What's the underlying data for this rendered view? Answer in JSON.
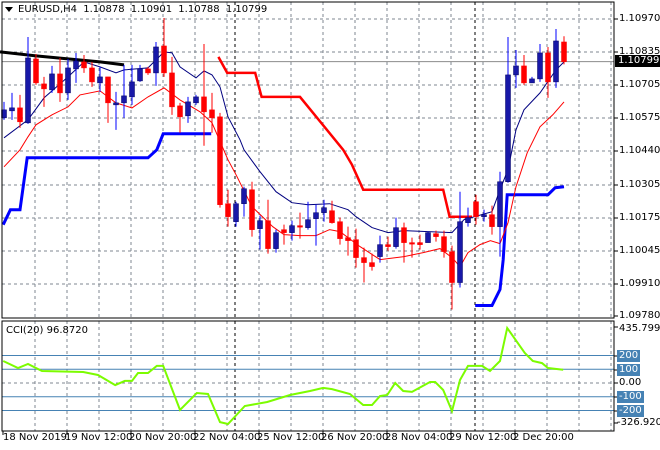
{
  "header": {
    "symbol": "EURUSD,H4",
    "open": "1.10878",
    "high": "1.10901",
    "low": "1.10788",
    "close": "1.10799"
  },
  "price_axis": [
    "1.10970",
    "1.10835",
    "1.10705",
    "1.10575",
    "1.10440",
    "1.10305",
    "1.10175",
    "1.10045",
    "1.09910",
    "1.09780"
  ],
  "current_price": "1.10799",
  "time_axis": [
    "18 Nov 2019",
    "19 Nov 12:00",
    "20 Nov 20:00",
    "22 Nov 04:00",
    "25 Nov 12:00",
    "26 Nov 20:00",
    "28 Nov 04:00",
    "29 Nov 12:00",
    "2 Dec 20:00"
  ],
  "indicator": {
    "label": "CCI(20) 96.8720",
    "max": "435.799",
    "min": "-326.9205",
    "zero": "0.00",
    "levels": [
      "200",
      "100",
      "-100",
      "-200"
    ]
  },
  "colors": {
    "bull": "#1818a8",
    "bear": "#ff0000",
    "ma_fast": "#000080",
    "ma_slow": "#ff0000",
    "stop_up": "#0000ff",
    "stop_down": "#ff0000",
    "cci": "#7cfc00",
    "level": "#4682b4"
  },
  "chart_data": {
    "type": "candlestick",
    "price_range": [
      1.0978,
      1.1097
    ],
    "ohlc": [
      [
        1.10574,
        1.10638,
        1.10566,
        1.10606
      ],
      [
        1.10602,
        1.10674,
        1.10566,
        1.10614
      ],
      [
        1.10614,
        1.10666,
        1.10534,
        1.10558
      ],
      [
        1.10554,
        1.10898,
        1.1055,
        1.10814
      ],
      [
        1.1081,
        1.1083,
        1.10706,
        1.10714
      ],
      [
        1.1071,
        1.10738,
        1.10618,
        1.1069
      ],
      [
        1.10686,
        1.10782,
        1.10674,
        1.1075
      ],
      [
        1.1075,
        1.10814,
        1.10638,
        1.10674
      ],
      [
        1.10674,
        1.1081,
        1.10646,
        1.10774
      ],
      [
        1.1077,
        1.10834,
        1.10714,
        1.10802
      ],
      [
        1.10798,
        1.10826,
        1.10754,
        1.10774
      ],
      [
        1.10774,
        1.10798,
        1.10698,
        1.10718
      ],
      [
        1.10714,
        1.10778,
        1.10678,
        1.10738
      ],
      [
        1.10738,
        1.10738,
        1.10554,
        1.10634
      ],
      [
        1.10626,
        1.10678,
        1.10526,
        1.10634
      ],
      [
        1.10634,
        1.10786,
        1.10574,
        1.10662
      ],
      [
        1.10658,
        1.10786,
        1.10626,
        1.10718
      ],
      [
        1.10722,
        1.10786,
        1.10718,
        1.1077
      ],
      [
        1.1077,
        1.10778,
        1.10746,
        1.10754
      ],
      [
        1.10754,
        1.10878,
        1.10702,
        1.10858
      ],
      [
        1.10862,
        1.10974,
        1.10738,
        1.10754
      ],
      [
        1.10754,
        1.10818,
        1.10586,
        1.10618
      ],
      [
        1.10622,
        1.10634,
        1.10514,
        1.10578
      ],
      [
        1.10582,
        1.10658,
        1.10554,
        1.10638
      ],
      [
        1.10634,
        1.10666,
        1.10626,
        1.10658
      ],
      [
        1.10658,
        1.1087,
        1.10462,
        1.10598
      ],
      [
        1.10606,
        1.10674,
        1.10514,
        1.10574
      ],
      [
        1.10578,
        1.10594,
        1.10214,
        1.10226
      ],
      [
        1.1023,
        1.10286,
        1.10138,
        1.10178
      ],
      [
        1.10158,
        1.10238,
        1.10138,
        1.1023
      ],
      [
        1.1023,
        1.10298,
        1.10178,
        1.1029
      ],
      [
        1.10286,
        1.10318,
        1.10098,
        1.10126
      ],
      [
        1.1013,
        1.10182,
        1.10046,
        1.10162
      ],
      [
        1.10162,
        1.10246,
        1.1003,
        1.1005
      ],
      [
        1.1005,
        1.10126,
        1.10034,
        1.10114
      ],
      [
        1.10126,
        1.10146,
        1.10066,
        1.10114
      ],
      [
        1.10114,
        1.10162,
        1.10082,
        1.10142
      ],
      [
        1.10142,
        1.10194,
        1.1009,
        1.10138
      ],
      [
        1.10134,
        1.10238,
        1.10126,
        1.10166
      ],
      [
        1.1017,
        1.10226,
        1.10062,
        1.10194
      ],
      [
        1.10194,
        1.10246,
        1.10158,
        1.10214
      ],
      [
        1.10202,
        1.10242,
        1.1015,
        1.10154
      ],
      [
        1.10158,
        1.10174,
        1.10066,
        1.1009
      ],
      [
        1.10094,
        1.10138,
        1.10022,
        1.10082
      ],
      [
        1.10086,
        1.1013,
        1.09974,
        1.10014
      ],
      [
        1.10014,
        1.10054,
        1.09914,
        1.09994
      ],
      [
        1.09994,
        1.1003,
        1.09962,
        1.09978
      ],
      [
        1.10018,
        1.10102,
        1.09994,
        1.10066
      ],
      [
        1.10066,
        1.10098,
        1.10042,
        1.10058
      ],
      [
        1.10058,
        1.10174,
        1.1005,
        1.10134
      ],
      [
        1.10134,
        1.10154,
        1.09994,
        1.10074
      ],
      [
        1.10074,
        1.10094,
        1.10014,
        1.1007
      ],
      [
        1.10074,
        1.10106,
        1.10046,
        1.10066
      ],
      [
        1.10074,
        1.10118,
        1.10074,
        1.10114
      ],
      [
        1.1011,
        1.10122,
        1.10078,
        1.10098
      ],
      [
        1.10098,
        1.10122,
        1.10014,
        1.10038
      ],
      [
        1.10038,
        1.10062,
        1.09806,
        1.09914
      ],
      [
        1.09914,
        1.10278,
        1.09894,
        1.10158
      ],
      [
        1.10154,
        1.10214,
        1.10138,
        1.10174
      ],
      [
        1.10238,
        1.10266,
        1.10146,
        1.10178
      ],
      [
        1.10178,
        1.10206,
        1.10158,
        1.10186
      ],
      [
        1.10186,
        1.10222,
        1.10106,
        1.10138
      ],
      [
        1.10138,
        1.10358,
        1.10018,
        1.10318
      ],
      [
        1.10318,
        1.10898,
        1.10314,
        1.10746
      ],
      [
        1.10746,
        1.10846,
        1.10694,
        1.10782
      ],
      [
        1.10782,
        1.10826,
        1.10706,
        1.10714
      ],
      [
        1.10714,
        1.10738,
        1.10714,
        1.1073
      ],
      [
        1.1073,
        1.1087,
        1.10718,
        1.10834
      ],
      [
        1.10834,
        1.10858,
        1.10654,
        1.10718
      ],
      [
        1.10718,
        1.1093,
        1.10694,
        1.10882
      ],
      [
        1.10878,
        1.10901,
        1.10788,
        1.10799
      ]
    ],
    "overlays": {
      "ma_fast": [
        [
          0,
          1.10494
        ],
        [
          3,
          1.10566
        ],
        [
          5,
          1.10654
        ],
        [
          8,
          1.10738
        ],
        [
          10,
          1.10798
        ],
        [
          12,
          1.10778
        ],
        [
          14,
          1.10754
        ],
        [
          15,
          1.10766
        ],
        [
          18,
          1.10774
        ],
        [
          20,
          1.10838
        ],
        [
          21,
          1.10834
        ],
        [
          22,
          1.10778
        ],
        [
          24,
          1.10734
        ],
        [
          25,
          1.10762
        ],
        [
          26,
          1.10746
        ],
        [
          27,
          1.10698
        ],
        [
          28,
          1.10578
        ],
        [
          29.5,
          1.10486
        ],
        [
          30,
          1.10446
        ],
        [
          32,
          1.10358
        ],
        [
          34,
          1.10278
        ],
        [
          36,
          1.10234
        ],
        [
          38,
          1.10226
        ],
        [
          40.7,
          1.1023
        ],
        [
          43,
          1.10206
        ],
        [
          44,
          1.10178
        ],
        [
          46,
          1.10134
        ],
        [
          48,
          1.10114
        ],
        [
          50,
          1.10122
        ],
        [
          53,
          1.10118
        ],
        [
          56,
          1.10114
        ],
        [
          57.5,
          1.10166
        ],
        [
          61,
          1.10198
        ],
        [
          62,
          1.10286
        ],
        [
          63,
          1.10366
        ],
        [
          64,
          1.10526
        ],
        [
          65,
          1.10606
        ],
        [
          67,
          1.10674
        ],
        [
          69,
          1.10766
        ],
        [
          70,
          1.10798
        ]
      ],
      "ma_slow": [
        [
          0,
          1.10378
        ],
        [
          2,
          1.10446
        ],
        [
          3,
          1.10498
        ],
        [
          4,
          1.10546
        ],
        [
          6,
          1.10586
        ],
        [
          8,
          1.10618
        ],
        [
          9.5,
          1.10666
        ],
        [
          12,
          1.10682
        ],
        [
          14,
          1.10634
        ],
        [
          16,
          1.10614
        ],
        [
          18,
          1.10658
        ],
        [
          20,
          1.10694
        ],
        [
          22,
          1.10646
        ],
        [
          24.5,
          1.10598
        ],
        [
          26,
          1.10554
        ],
        [
          28,
          1.10406
        ],
        [
          29,
          1.10346
        ],
        [
          31,
          1.10218
        ],
        [
          33.6,
          1.10138
        ],
        [
          35,
          1.10106
        ],
        [
          37,
          1.10102
        ],
        [
          39,
          1.10102
        ],
        [
          40.7,
          1.10126
        ],
        [
          42,
          1.10118
        ],
        [
          44.5,
          1.10058
        ],
        [
          47,
          1.10006
        ],
        [
          50,
          1.10018
        ],
        [
          52.4,
          1.10034
        ],
        [
          54.5,
          1.1005
        ],
        [
          56,
          1.10014
        ],
        [
          57,
          1.09978
        ],
        [
          58,
          1.10034
        ],
        [
          59.5,
          1.10066
        ],
        [
          60.8,
          1.10082
        ],
        [
          62,
          1.1007
        ],
        [
          63,
          1.10154
        ],
        [
          64,
          1.10298
        ],
        [
          65.4,
          1.10434
        ],
        [
          67,
          1.10538
        ],
        [
          68.6,
          1.10586
        ],
        [
          70,
          1.10638
        ]
      ],
      "stop_up_1": [
        [
          -0.1,
          1.10146
        ],
        [
          0.8,
          1.10206
        ],
        [
          2,
          1.10206
        ],
        [
          2.9,
          1.10414
        ],
        [
          18,
          1.10414
        ],
        [
          19.1,
          1.10446
        ],
        [
          19.9,
          1.1051
        ],
        [
          25.9,
          1.1051
        ]
      ],
      "stop_up_2": [
        [
          58.9,
          1.09822
        ],
        [
          61,
          1.09822
        ],
        [
          62,
          1.09886
        ],
        [
          62.4,
          1.10006
        ],
        [
          62.9,
          1.10266
        ],
        [
          68,
          1.10266
        ],
        [
          68.9,
          1.10294
        ],
        [
          70,
          1.10298
        ]
      ],
      "stop_down": [
        [
          26.8,
          1.10818
        ],
        [
          27.9,
          1.10754
        ],
        [
          31.4,
          1.10754
        ],
        [
          32.2,
          1.10658
        ],
        [
          37,
          1.10658
        ],
        [
          42.4,
          1.10446
        ],
        [
          43.5,
          1.10386
        ],
        [
          44.9,
          1.10286
        ],
        [
          54.9,
          1.10286
        ],
        [
          55.7,
          1.10178
        ],
        [
          58.5,
          1.10178
        ]
      ],
      "trend": [
        [
          -0.5,
          1.10838
        ],
        [
          4,
          1.10822
        ],
        [
          8,
          1.1081
        ],
        [
          12,
          1.10798
        ],
        [
          15,
          1.10786
        ]
      ]
    },
    "cci": {
      "range": [
        -326.9205,
        435.799
      ],
      "levels": [
        200,
        100,
        0,
        -100,
        -200
      ],
      "points": [
        [
          -0.1,
          160
        ],
        [
          1.75,
          109
        ],
        [
          3,
          138
        ],
        [
          4.75,
          87
        ],
        [
          9.9,
          80
        ],
        [
          11.75,
          58
        ],
        [
          13.9,
          -15
        ],
        [
          15.1,
          15
        ],
        [
          16,
          15
        ],
        [
          16.75,
          73
        ],
        [
          18,
          73
        ],
        [
          19.1,
          124
        ],
        [
          19.9,
          124
        ],
        [
          22,
          -196
        ],
        [
          24.1,
          -73
        ],
        [
          25.5,
          -80
        ],
        [
          27,
          -284
        ],
        [
          28,
          -298
        ],
        [
          30.1,
          -167
        ],
        [
          32.9,
          -138
        ],
        [
          35.75,
          -87
        ],
        [
          38.25,
          -58
        ],
        [
          39.9,
          -36
        ],
        [
          41,
          -44
        ],
        [
          43.25,
          -80
        ],
        [
          44.9,
          -160
        ],
        [
          46,
          -160
        ],
        [
          47,
          -95
        ],
        [
          47.9,
          -87
        ],
        [
          48.9,
          0
        ],
        [
          49.9,
          -58
        ],
        [
          51,
          -65
        ],
        [
          53.25,
          7
        ],
        [
          53.9,
          7
        ],
        [
          54.9,
          -51
        ],
        [
          56,
          -204
        ],
        [
          57,
          22
        ],
        [
          58,
          124
        ],
        [
          59.75,
          124
        ],
        [
          60.75,
          87
        ],
        [
          62,
          160
        ],
        [
          62.9,
          400
        ],
        [
          65.1,
          218
        ],
        [
          66.1,
          160
        ],
        [
          67.25,
          145
        ],
        [
          68,
          109
        ],
        [
          69.9,
          97
        ]
      ]
    }
  }
}
